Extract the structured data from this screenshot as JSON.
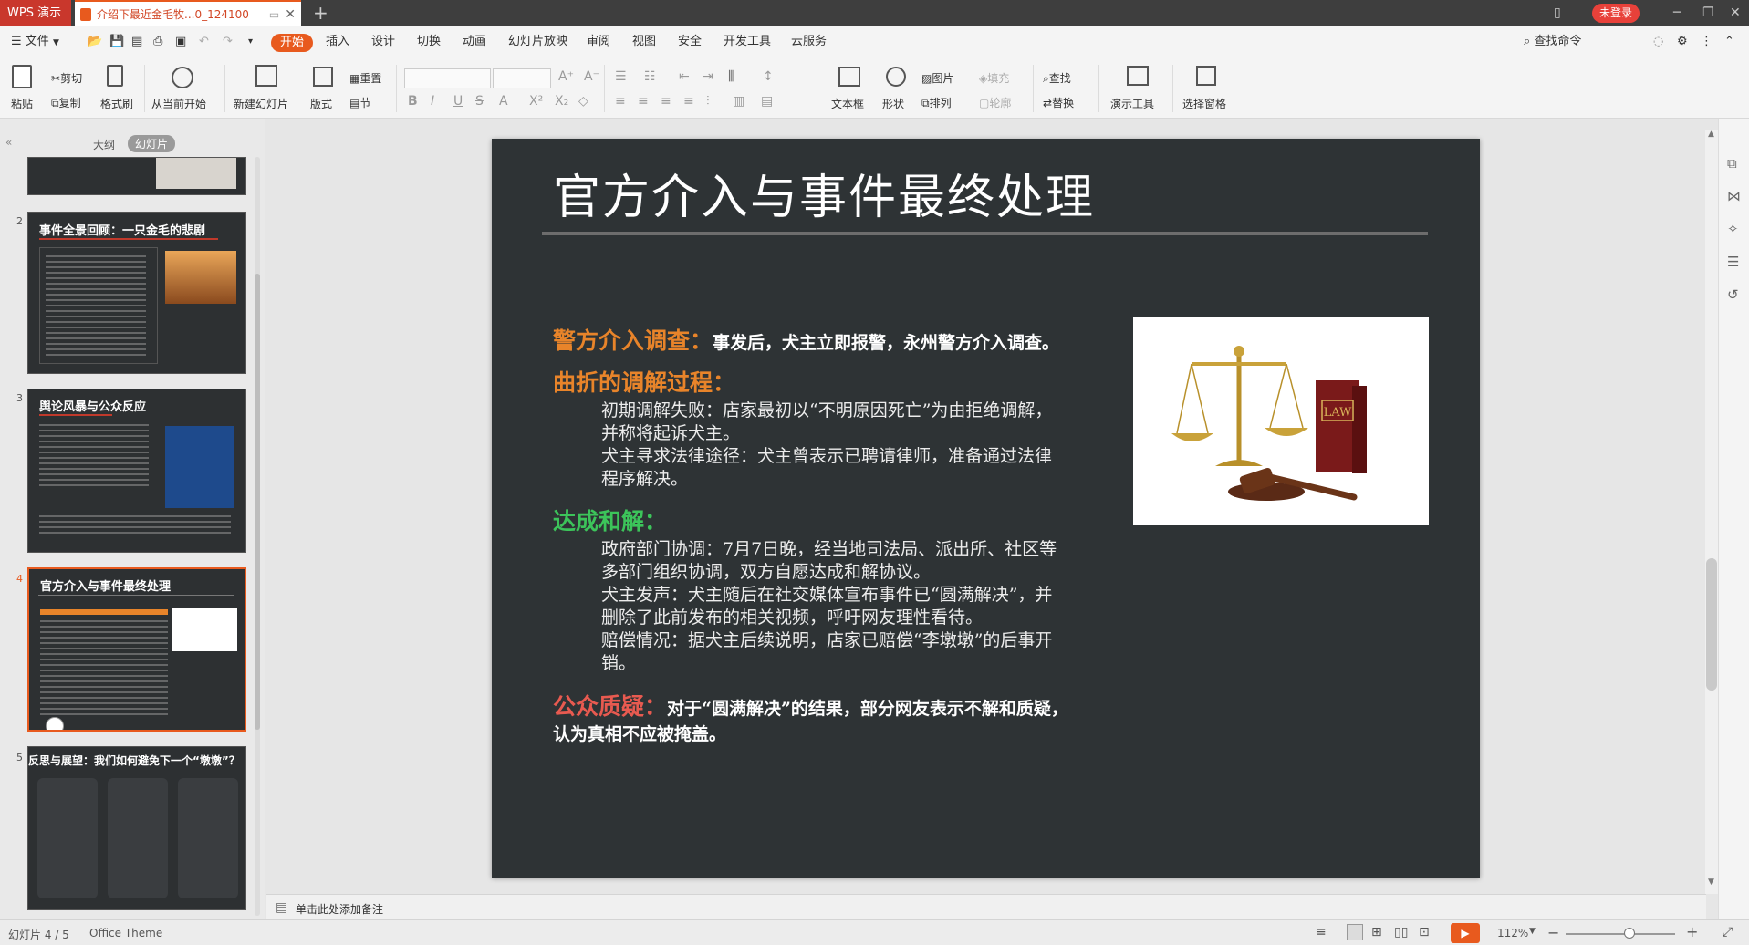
{
  "titlebar": {
    "app_name": "WPS 演示",
    "doc_tab": "介绍下最近金毛牧...0_124100",
    "login_label": "未登录"
  },
  "menubar": {
    "file": "文件",
    "items": [
      "开始",
      "插入",
      "设计",
      "切换",
      "动画",
      "幻灯片放映",
      "审阅",
      "视图",
      "安全",
      "开发工具",
      "云服务"
    ],
    "search": "查找命令"
  },
  "ribbon": {
    "paste": "粘贴",
    "cut": "剪切",
    "copy": "复制",
    "format_painter": "格式刷",
    "from_current": "从当前开始",
    "new_slide": "新建幻灯片",
    "layout": "版式",
    "reset": "重置",
    "section": "节",
    "text_box": "文本框",
    "shape": "形状",
    "picture": "图片",
    "arrange": "排列",
    "fill": "填充",
    "outline": "轮廓",
    "find": "查找",
    "replace": "替换",
    "present_tools": "演示工具",
    "select_pane": "选择窗格"
  },
  "left_panel": {
    "tab_outline": "大纲",
    "tab_slides": "幻灯片",
    "slides": [
      {
        "num": "2",
        "title": "事件全景回顾：一只金毛的悲剧"
      },
      {
        "num": "3",
        "title": "舆论风暴与公众反应"
      },
      {
        "num": "4",
        "title": "官方介入与事件最终处理"
      },
      {
        "num": "5",
        "title": "反思与展望：我们如何避免下一个“墩墩”？"
      }
    ]
  },
  "slide": {
    "title": "官方介入与事件最终处理",
    "police_head": "警方介入调查：",
    "police_text": "事发后，犬主立即报警，永州警方介入调查。",
    "mediation_head": "曲折的调解过程：",
    "mediation_lines": [
      "初期调解失败：店家最初以“不明原因死亡”为由拒绝调解，",
      "并称将起诉犬主。",
      "犬主寻求法律途径：犬主曾表示已聘请律师，准备通过法律",
      "程序解决。"
    ],
    "settlement_head": "达成和解：",
    "settlement_lines": [
      "政府部门协调：7月7日晚，经当地司法局、派出所、社区等",
      "多部门组织协调，双方自愿达成和解协议。",
      "犬主发声：犬主随后在社交媒体宣布事件已“圆满解决”，并",
      "删除了此前发布的相关视频，呼吁网友理性看待。",
      "赔偿情况：据犬主后续说明，店家已赔偿“李墩墩”的后事开",
      "销。"
    ],
    "doubt_head": "公众质疑：",
    "doubt_lines": [
      "对于“圆满解决”的结果，部分网友表示不解和质疑，",
      "认为真相不应被掩盖。"
    ],
    "law_book_label": "LAW"
  },
  "notes": {
    "placeholder": "单击此处添加备注"
  },
  "statusbar": {
    "slide_indicator": "幻灯片 4 / 5",
    "theme": "Office Theme",
    "zoom": "112%"
  },
  "colors": {
    "orange": "#e8842a",
    "green": "#3cc45a",
    "red": "#e85a50",
    "slide_bg": "#2e3335"
  }
}
